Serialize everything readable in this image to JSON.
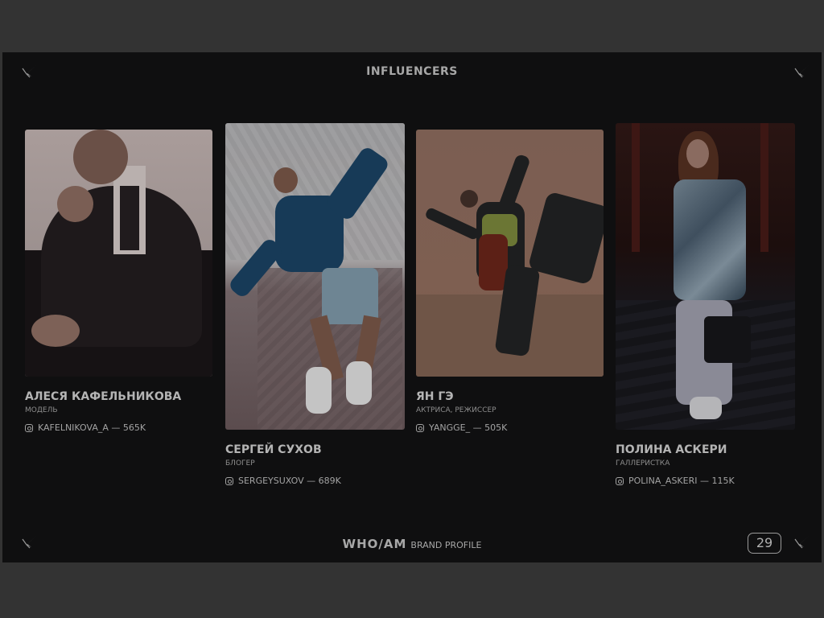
{
  "header": {
    "title": "INFLUENCERS"
  },
  "influencers": [
    {
      "name": "АЛЕСЯ КАФЕЛЬНИКОВА",
      "role": "МОДЕЛЬ",
      "handle": "KAFELNIKOVA_A — 565K",
      "icon": "instagram-icon"
    },
    {
      "name": "СЕРГЕЙ СУХОВ",
      "role": "БЛОГЕР",
      "handle": "SERGEYSUXOV — 689K",
      "icon": "instagram-icon"
    },
    {
      "name": "ЯН ГЭ",
      "role": "АКТРИСА, РЕЖИССЕР",
      "handle": "YANGGE_ — 505K",
      "icon": "instagram-icon"
    },
    {
      "name": "ПОЛИНА АСКЕРИ",
      "role": "ГАЛЛЕРИСТКА",
      "handle": "POLINA_ASKERI — 115K",
      "icon": "instagram-icon"
    }
  ],
  "footer": {
    "brand": "WHO/AM",
    "subtitle": "BRAND PROFILE",
    "page_number": "29"
  },
  "colors": {
    "background": "#0f0f10",
    "outer": "#333333",
    "text": "#b4b4b4"
  },
  "icons": [
    "sparkle-star-icon",
    "instagram-icon"
  ]
}
